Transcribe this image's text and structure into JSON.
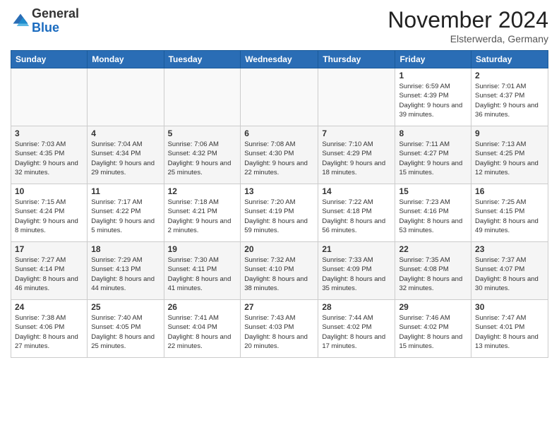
{
  "header": {
    "logo_general": "General",
    "logo_blue": "Blue",
    "month_title": "November 2024",
    "location": "Elsterwerda, Germany"
  },
  "days_of_week": [
    "Sunday",
    "Monday",
    "Tuesday",
    "Wednesday",
    "Thursday",
    "Friday",
    "Saturday"
  ],
  "weeks": [
    [
      {
        "day": "",
        "sunrise": "",
        "sunset": "",
        "daylight": ""
      },
      {
        "day": "",
        "sunrise": "",
        "sunset": "",
        "daylight": ""
      },
      {
        "day": "",
        "sunrise": "",
        "sunset": "",
        "daylight": ""
      },
      {
        "day": "",
        "sunrise": "",
        "sunset": "",
        "daylight": ""
      },
      {
        "day": "",
        "sunrise": "",
        "sunset": "",
        "daylight": ""
      },
      {
        "day": "1",
        "sunrise": "Sunrise: 6:59 AM",
        "sunset": "Sunset: 4:39 PM",
        "daylight": "Daylight: 9 hours and 39 minutes."
      },
      {
        "day": "2",
        "sunrise": "Sunrise: 7:01 AM",
        "sunset": "Sunset: 4:37 PM",
        "daylight": "Daylight: 9 hours and 36 minutes."
      }
    ],
    [
      {
        "day": "3",
        "sunrise": "Sunrise: 7:03 AM",
        "sunset": "Sunset: 4:35 PM",
        "daylight": "Daylight: 9 hours and 32 minutes."
      },
      {
        "day": "4",
        "sunrise": "Sunrise: 7:04 AM",
        "sunset": "Sunset: 4:34 PM",
        "daylight": "Daylight: 9 hours and 29 minutes."
      },
      {
        "day": "5",
        "sunrise": "Sunrise: 7:06 AM",
        "sunset": "Sunset: 4:32 PM",
        "daylight": "Daylight: 9 hours and 25 minutes."
      },
      {
        "day": "6",
        "sunrise": "Sunrise: 7:08 AM",
        "sunset": "Sunset: 4:30 PM",
        "daylight": "Daylight: 9 hours and 22 minutes."
      },
      {
        "day": "7",
        "sunrise": "Sunrise: 7:10 AM",
        "sunset": "Sunset: 4:29 PM",
        "daylight": "Daylight: 9 hours and 18 minutes."
      },
      {
        "day": "8",
        "sunrise": "Sunrise: 7:11 AM",
        "sunset": "Sunset: 4:27 PM",
        "daylight": "Daylight: 9 hours and 15 minutes."
      },
      {
        "day": "9",
        "sunrise": "Sunrise: 7:13 AM",
        "sunset": "Sunset: 4:25 PM",
        "daylight": "Daylight: 9 hours and 12 minutes."
      }
    ],
    [
      {
        "day": "10",
        "sunrise": "Sunrise: 7:15 AM",
        "sunset": "Sunset: 4:24 PM",
        "daylight": "Daylight: 9 hours and 8 minutes."
      },
      {
        "day": "11",
        "sunrise": "Sunrise: 7:17 AM",
        "sunset": "Sunset: 4:22 PM",
        "daylight": "Daylight: 9 hours and 5 minutes."
      },
      {
        "day": "12",
        "sunrise": "Sunrise: 7:18 AM",
        "sunset": "Sunset: 4:21 PM",
        "daylight": "Daylight: 9 hours and 2 minutes."
      },
      {
        "day": "13",
        "sunrise": "Sunrise: 7:20 AM",
        "sunset": "Sunset: 4:19 PM",
        "daylight": "Daylight: 8 hours and 59 minutes."
      },
      {
        "day": "14",
        "sunrise": "Sunrise: 7:22 AM",
        "sunset": "Sunset: 4:18 PM",
        "daylight": "Daylight: 8 hours and 56 minutes."
      },
      {
        "day": "15",
        "sunrise": "Sunrise: 7:23 AM",
        "sunset": "Sunset: 4:16 PM",
        "daylight": "Daylight: 8 hours and 53 minutes."
      },
      {
        "day": "16",
        "sunrise": "Sunrise: 7:25 AM",
        "sunset": "Sunset: 4:15 PM",
        "daylight": "Daylight: 8 hours and 49 minutes."
      }
    ],
    [
      {
        "day": "17",
        "sunrise": "Sunrise: 7:27 AM",
        "sunset": "Sunset: 4:14 PM",
        "daylight": "Daylight: 8 hours and 46 minutes."
      },
      {
        "day": "18",
        "sunrise": "Sunrise: 7:29 AM",
        "sunset": "Sunset: 4:13 PM",
        "daylight": "Daylight: 8 hours and 44 minutes."
      },
      {
        "day": "19",
        "sunrise": "Sunrise: 7:30 AM",
        "sunset": "Sunset: 4:11 PM",
        "daylight": "Daylight: 8 hours and 41 minutes."
      },
      {
        "day": "20",
        "sunrise": "Sunrise: 7:32 AM",
        "sunset": "Sunset: 4:10 PM",
        "daylight": "Daylight: 8 hours and 38 minutes."
      },
      {
        "day": "21",
        "sunrise": "Sunrise: 7:33 AM",
        "sunset": "Sunset: 4:09 PM",
        "daylight": "Daylight: 8 hours and 35 minutes."
      },
      {
        "day": "22",
        "sunrise": "Sunrise: 7:35 AM",
        "sunset": "Sunset: 4:08 PM",
        "daylight": "Daylight: 8 hours and 32 minutes."
      },
      {
        "day": "23",
        "sunrise": "Sunrise: 7:37 AM",
        "sunset": "Sunset: 4:07 PM",
        "daylight": "Daylight: 8 hours and 30 minutes."
      }
    ],
    [
      {
        "day": "24",
        "sunrise": "Sunrise: 7:38 AM",
        "sunset": "Sunset: 4:06 PM",
        "daylight": "Daylight: 8 hours and 27 minutes."
      },
      {
        "day": "25",
        "sunrise": "Sunrise: 7:40 AM",
        "sunset": "Sunset: 4:05 PM",
        "daylight": "Daylight: 8 hours and 25 minutes."
      },
      {
        "day": "26",
        "sunrise": "Sunrise: 7:41 AM",
        "sunset": "Sunset: 4:04 PM",
        "daylight": "Daylight: 8 hours and 22 minutes."
      },
      {
        "day": "27",
        "sunrise": "Sunrise: 7:43 AM",
        "sunset": "Sunset: 4:03 PM",
        "daylight": "Daylight: 8 hours and 20 minutes."
      },
      {
        "day": "28",
        "sunrise": "Sunrise: 7:44 AM",
        "sunset": "Sunset: 4:02 PM",
        "daylight": "Daylight: 8 hours and 17 minutes."
      },
      {
        "day": "29",
        "sunrise": "Sunrise: 7:46 AM",
        "sunset": "Sunset: 4:02 PM",
        "daylight": "Daylight: 8 hours and 15 minutes."
      },
      {
        "day": "30",
        "sunrise": "Sunrise: 7:47 AM",
        "sunset": "Sunset: 4:01 PM",
        "daylight": "Daylight: 8 hours and 13 minutes."
      }
    ]
  ]
}
